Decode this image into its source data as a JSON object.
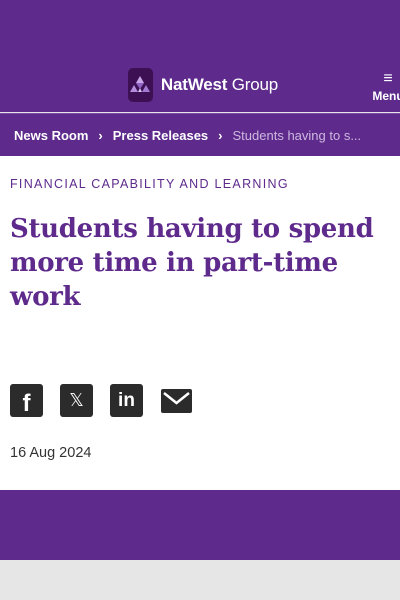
{
  "header": {
    "brand_bold": "NatWest",
    "brand_rest": " Group",
    "menu_label": "Menu",
    "colors": {
      "primary": "#5e2a8c",
      "logo_bg": "#3c1053"
    }
  },
  "breadcrumb": {
    "items": [
      "News Room",
      "Press Releases",
      "Students having to s..."
    ],
    "separator": "›"
  },
  "article": {
    "category": "FINANCIAL CAPABILITY AND LEARNING",
    "title": "Students having to spend more time in part-time work",
    "date": "16 Aug 2024"
  },
  "share": {
    "icons": [
      "facebook-icon",
      "x-icon",
      "linkedin-icon",
      "email-icon"
    ],
    "facebook_glyph": "f",
    "x_glyph": "𝕏",
    "linkedin_glyph": "in"
  }
}
